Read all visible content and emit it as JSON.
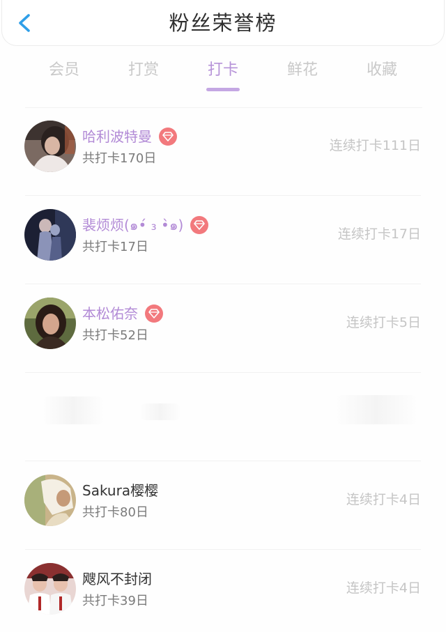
{
  "header": {
    "title": "粉丝荣誉榜"
  },
  "tabs": [
    {
      "label": "会员",
      "active": false
    },
    {
      "label": "打赏",
      "active": false
    },
    {
      "label": "打卡",
      "active": true
    },
    {
      "label": "鲜花",
      "active": false
    },
    {
      "label": "收藏",
      "active": false
    }
  ],
  "colors": {
    "accent": "#b693d8",
    "member_name": "#b28ad6",
    "badge": "#f2797d",
    "back_icon": "#2f9fe8"
  },
  "fans": [
    {
      "name": "哈利波特曼",
      "total": "共打卡170日",
      "streak": "连续打卡111日",
      "member": true
    },
    {
      "name": "裴烦烦(๑•́ ₃ •̀๑)",
      "total": "共打卡17日",
      "streak": "连续打卡17日",
      "member": true
    },
    {
      "name": "本松佑奈",
      "total": "共打卡52日",
      "streak": "连续打卡5日",
      "member": true
    },
    {
      "name": "Sakura樱樱",
      "total": "共打卡80日",
      "streak": "连续打卡4日",
      "member": false
    },
    {
      "name": "飕风不封闭",
      "total": "共打卡39日",
      "streak": "连续打卡4日",
      "member": false
    }
  ]
}
